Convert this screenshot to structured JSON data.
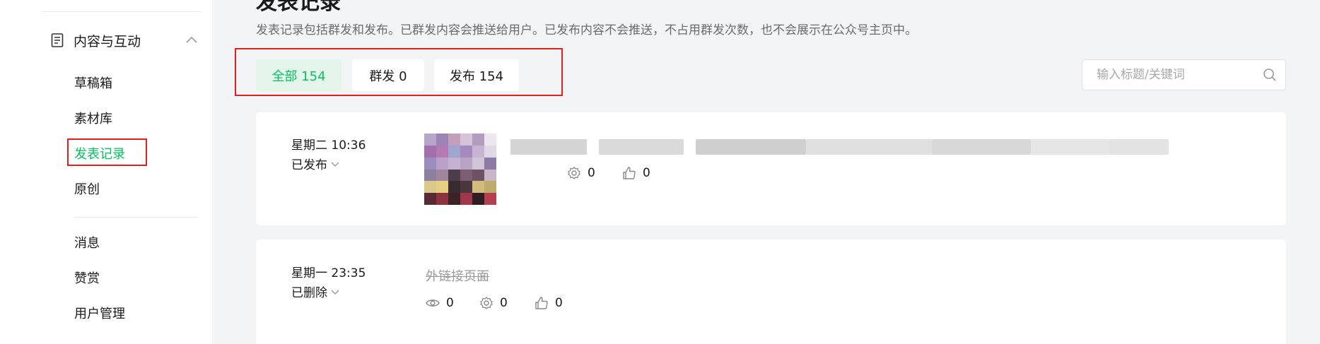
{
  "sidebar": {
    "group_label": "内容与互动",
    "items": [
      {
        "label": "草稿箱"
      },
      {
        "label": "素材库"
      },
      {
        "label": "发表记录",
        "active": true
      },
      {
        "label": "原创"
      }
    ],
    "items2": [
      {
        "label": "消息"
      },
      {
        "label": "赞赏"
      },
      {
        "label": "用户管理"
      }
    ]
  },
  "main": {
    "title": "发表记录",
    "description": "发表记录包括群发和发布。已群发内容会推送给用户。已发布内容不会推送，不占用群发次数，也不会展示在公众号主页中。",
    "tabs": [
      {
        "label": "全部 154",
        "active": true
      },
      {
        "label": "群发 0"
      },
      {
        "label": "发布 154"
      }
    ],
    "search": {
      "placeholder": "输入标题/关键词",
      "value": ""
    }
  },
  "records": [
    {
      "time": "星期二 10:36",
      "status": "已发布",
      "title_blurred": true,
      "stats": {
        "shares": "0",
        "likes": "0"
      }
    },
    {
      "time": "星期一 23:35",
      "status": "已删除",
      "title": "外链接页面",
      "stats": {
        "reads": "0",
        "shares": "0",
        "likes": "0"
      }
    }
  ],
  "colors": {
    "accent": "#07c160",
    "accent_bg": "#e4f6ec",
    "highlight_border": "#e02020",
    "page_bg": "#f3f4f6"
  },
  "icons": {
    "sidebar_group": "document-icon",
    "collapse": "chevron-up-icon",
    "search": "search-icon",
    "reads": "eye-icon",
    "shares": "gear-share-icon",
    "likes": "thumbs-up-icon",
    "status_dropdown": "chevron-down-icon"
  }
}
